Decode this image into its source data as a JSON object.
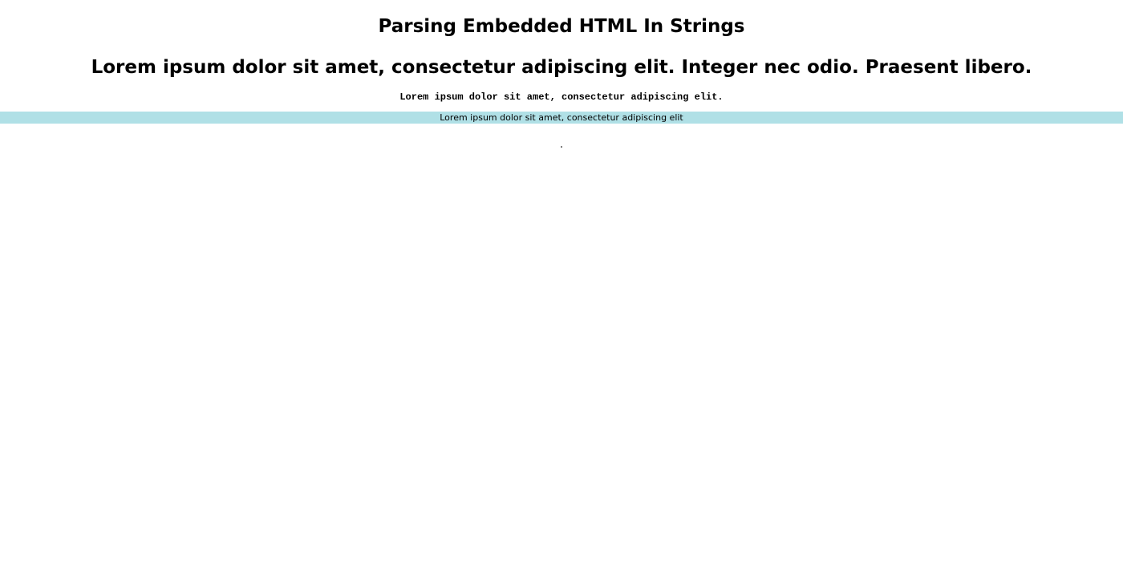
{
  "page": {
    "title": "Parsing Embedded HTML In Strings",
    "subheading": "Lorem ipsum dolor sit amet, consectetur adipiscing elit. Integer nec odio. Praesent libero.",
    "code_text": "Lorem ipsum dolor sit amet, consectetur adipiscing elit.",
    "banner_text": "Lorem ipsum dolor sit amet, consectetur adipiscing elit"
  },
  "colors": {
    "banner_background": "#b0e0e6",
    "text": "#000000",
    "background": "#ffffff"
  }
}
